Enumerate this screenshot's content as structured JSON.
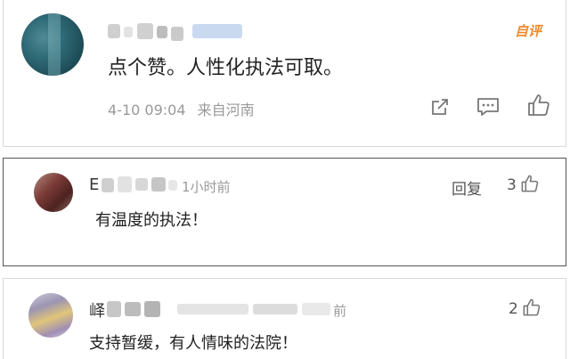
{
  "comments": [
    {
      "hot_label": "自评",
      "text": "点个赞。人性化执法可取。",
      "date": "4-10 09:04",
      "source": "来自河南",
      "icons": [
        "share-icon",
        "comment-icon",
        "like-icon"
      ]
    },
    {
      "name_prefix": "E",
      "time": "1小时前",
      "reply_label": "回复",
      "like_count": "3",
      "text": "有温度的执法！"
    },
    {
      "name_prefix": "峄",
      "time_fragment": "前",
      "like_count": "2",
      "text": "支持暂缓，有人情味的法院！"
    }
  ],
  "colors": {
    "hot_accent": "#f0892a",
    "meta_grey": "#999999",
    "border": "#d9d9d9"
  }
}
